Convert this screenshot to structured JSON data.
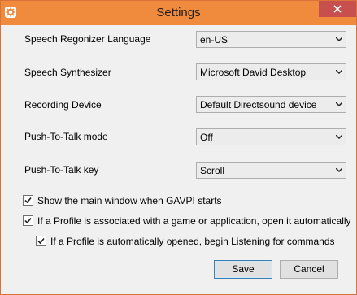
{
  "window": {
    "title": "Settings",
    "app_icon": "gear-icon",
    "close_icon": "close-icon"
  },
  "settings": {
    "rows": [
      {
        "label": "Speech Regonizer Language",
        "value": "en-US"
      },
      {
        "label": "Speech Synthesizer",
        "value": "Microsoft David Desktop"
      },
      {
        "label": "Recording Device",
        "value": "Default Directsound device"
      },
      {
        "label": "Push-To-Talk mode",
        "value": "Off"
      },
      {
        "label": "Push-To-Talk key",
        "value": "Scroll"
      }
    ]
  },
  "options": {
    "show_main_window": {
      "label": "Show the main window when GAVPI starts",
      "checked": true
    },
    "auto_open_profile": {
      "label": "If a Profile is associated with a game or application, open it automatically",
      "checked": true
    },
    "auto_listen": {
      "label": "If a Profile is automatically opened, begin Listening for commands",
      "checked": true
    }
  },
  "buttons": {
    "save": "Save",
    "cancel": "Cancel"
  },
  "colors": {
    "titlebar": "#f08a3c",
    "close_button": "#c7504f",
    "default_button_border": "#3c7fb1"
  }
}
